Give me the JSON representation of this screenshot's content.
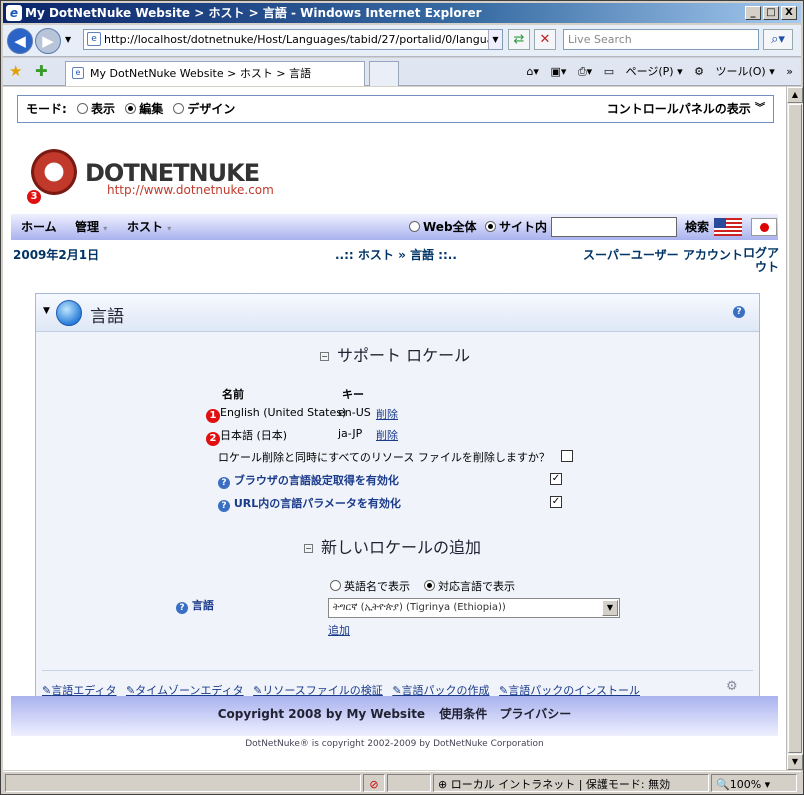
{
  "window": {
    "title": "My DotNetNuke Website > ホスト > 言語 - Windows Internet Explorer",
    "min": "_",
    "max": "□",
    "close": "X"
  },
  "browser": {
    "url": "http://localhost/dotnetnuke/Host/Languages/tabid/27/portalid/0/language",
    "search_placeholder": "Live Search",
    "tab_title": "My DotNetNuke Website > ホスト > 言語",
    "page_menu": "ページ(P)",
    "tools_menu": "ツール(O)"
  },
  "mode": {
    "label": "モード:",
    "view": "表示",
    "edit": "編集",
    "design": "デザイン",
    "selected": "edit",
    "control_panel": "コントロールパネルの表示"
  },
  "logo": {
    "name": "DOTNETNUKE",
    "url": "http://www.dotnetnuke.com",
    "badge": "3"
  },
  "menu": {
    "home": "ホーム",
    "admin": "管理",
    "host": "ホスト",
    "web_all": "Web全体",
    "site": "サイト内",
    "search_btn": "検索"
  },
  "date": "2009年2月1日",
  "breadcrumb": "..:: ホスト » 言語 ::..",
  "user": {
    "name": "スーパーユーザー アカウント",
    "logout": "ログアウト"
  },
  "panel": {
    "title": "言語",
    "support_header": "サポート ロケール",
    "col_name": "名前",
    "col_key": "キー",
    "locales": [
      {
        "badge": "1",
        "name": "English (United States)",
        "key": "en-US",
        "action": "削除"
      },
      {
        "badge": "2",
        "name": "日本語 (日本)",
        "key": "ja-JP",
        "action": "削除"
      }
    ],
    "delete_resources_q": "ロケール削除と同時にすべてのリソース ファイルを削除しますか？",
    "browser_lang": "ブラウザの言語設定取得を有効化",
    "url_lang": "URL内の言語パラメータを有効化",
    "add_header": "新しいロケールの追加",
    "display_english": "英語名で表示",
    "display_native": "対応言語で表示",
    "lang_label": "言語",
    "select_value": "ትግርኛ (ኢትዮጵያ) (Tigrinya (Ethiopia))",
    "add_link": "追加",
    "actions": [
      "言語エディタ",
      "タイムゾーンエディタ",
      "リソースファイルの検証",
      "言語パックの作成",
      "言語パックのインストール"
    ]
  },
  "footer": {
    "copyright": "Copyright 2008 by My Website",
    "terms": "使用条件",
    "privacy": "プライバシー",
    "dnn": "DotNetNuke® is copyright 2002-2009 by DotNetNuke Corporation"
  },
  "status": {
    "zone": "ローカル イントラネット | 保護モード: 無効",
    "zoom": "100%"
  }
}
